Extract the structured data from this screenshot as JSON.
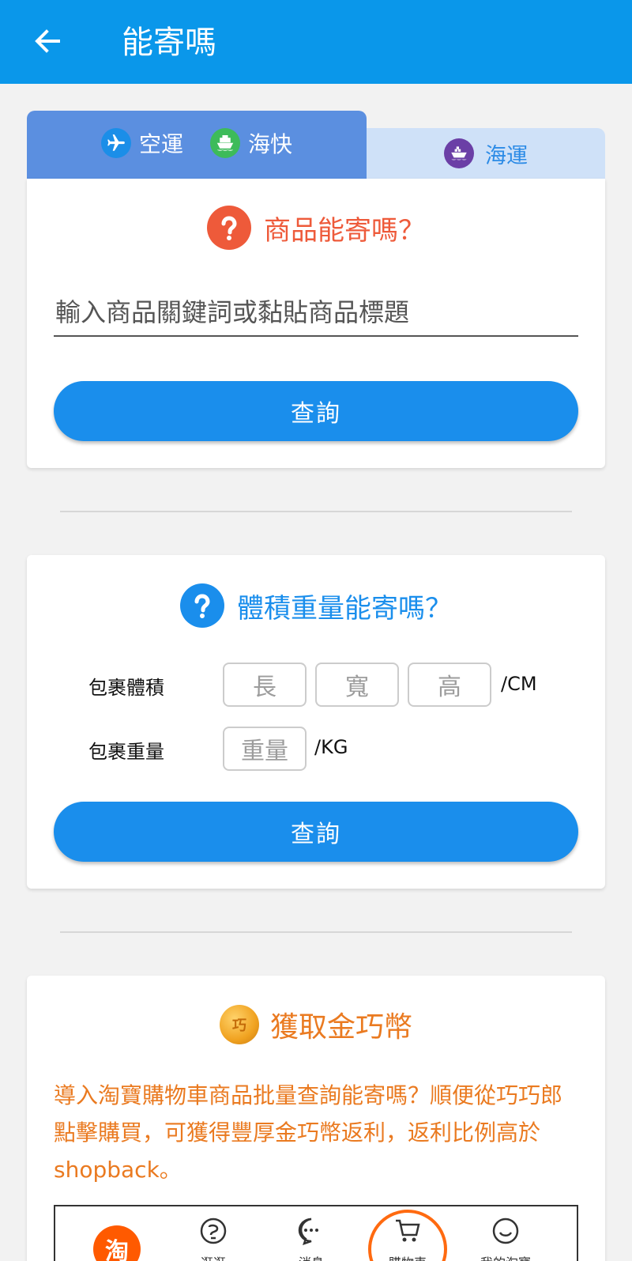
{
  "appbar": {
    "title": "能寄嗎",
    "back_icon": "arrow-left-icon"
  },
  "tabs": {
    "left": [
      {
        "label": "空運",
        "icon": "airplane-icon",
        "color": "#1b8ee8"
      },
      {
        "label": "海快",
        "icon": "ship-icon",
        "color": "#3dbb5a"
      }
    ],
    "right": {
      "label": "海運",
      "icon": "cargo-ship-icon",
      "color": "#6b3fa6"
    }
  },
  "product_check": {
    "title": "商品能寄嗎？",
    "accent": "#ee5a3a",
    "input_placeholder": "輸入商品關鍵詞或黏貼商品標題",
    "input_value": "",
    "button_label": "查詢"
  },
  "size_check": {
    "title": "體積重量能寄嗎？",
    "accent": "#1a8eec",
    "volume_label": "包裹體積",
    "length_placeholder": "長",
    "width_placeholder": "寬",
    "height_placeholder": "高",
    "volume_unit": "/CM",
    "weight_label": "包裹重量",
    "weight_placeholder": "重量",
    "weight_unit": "/KG",
    "button_label": "查詢"
  },
  "coins": {
    "coin_glyph": "巧",
    "title": "獲取金巧幣",
    "accent": "#ea7a20",
    "description": "導入淘寶購物車商品批量查詢能寄嗎？順便從巧巧郎點擊購買，可獲得豐厚金巧幣返利，返利比例高於shopback。",
    "preview_nav": [
      {
        "label": "",
        "icon": "taobao-logo-icon"
      },
      {
        "label": "逛逛",
        "icon": "browse-icon"
      },
      {
        "label": "消息",
        "icon": "message-icon"
      },
      {
        "label": "購物車",
        "icon": "cart-icon"
      },
      {
        "label": "我的淘寶",
        "icon": "smile-icon"
      }
    ]
  }
}
